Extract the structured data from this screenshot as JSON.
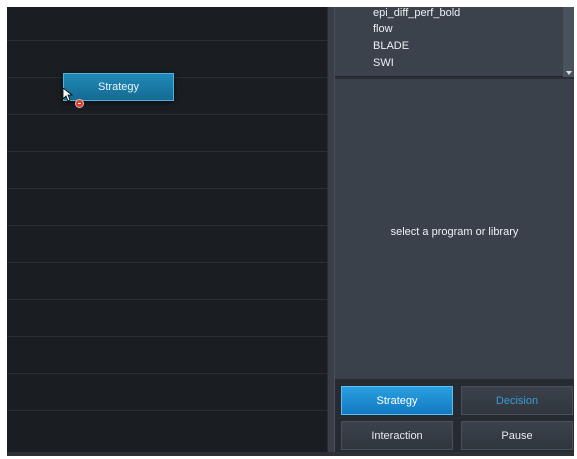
{
  "program_list": {
    "items": [
      "epi_diff_perf_bold",
      "flow",
      "BLADE",
      "SWI"
    ]
  },
  "canvas": {
    "node_label": "Strategy",
    "remove_icon": "remove-icon",
    "cursor_icon": "cursor-arrow-icon"
  },
  "detail": {
    "message": "select a program or library"
  },
  "buttons": {
    "strategy": "Strategy",
    "decision": "Decision",
    "interaction": "Interaction",
    "pause": "Pause"
  },
  "colors": {
    "accent": "#1a8fd6",
    "decision_text": "#3b9bd8",
    "node": "#1a7ea8"
  }
}
